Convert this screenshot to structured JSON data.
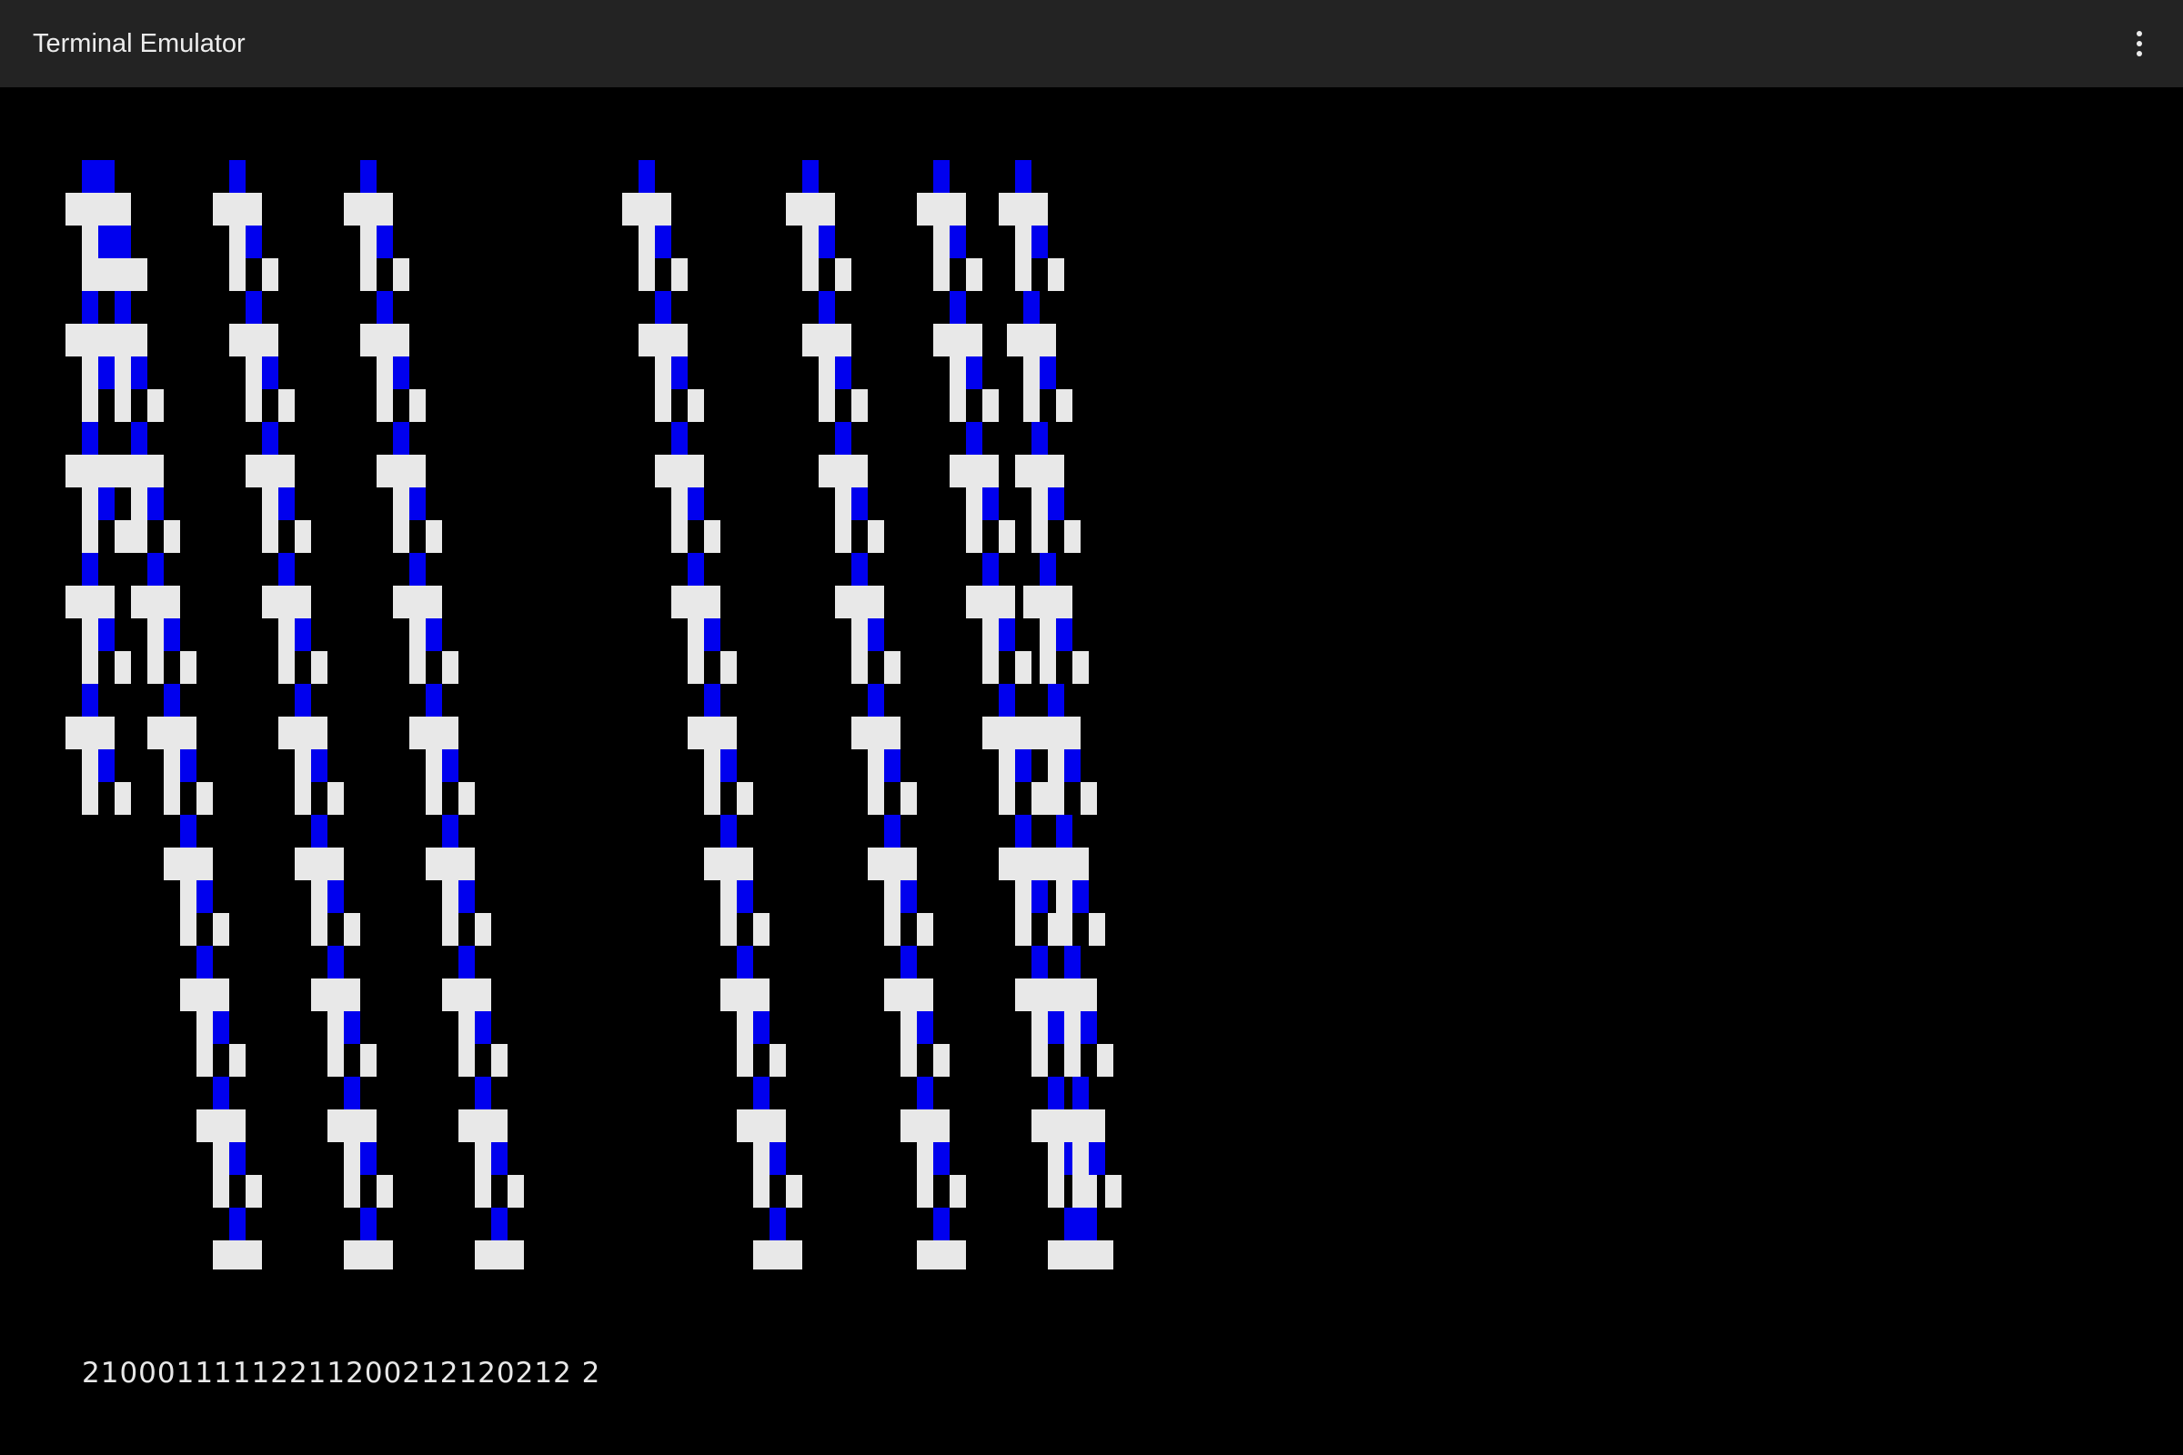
{
  "window": {
    "title": "Terminal Emulator",
    "menu_icon": "overflow-menu-icon"
  },
  "terminal": {
    "output_line": "21000111112211200212120212 2",
    "colors": {
      "background": "#000000",
      "white": "#e8e8e8",
      "blue": "#0000ee"
    }
  }
}
